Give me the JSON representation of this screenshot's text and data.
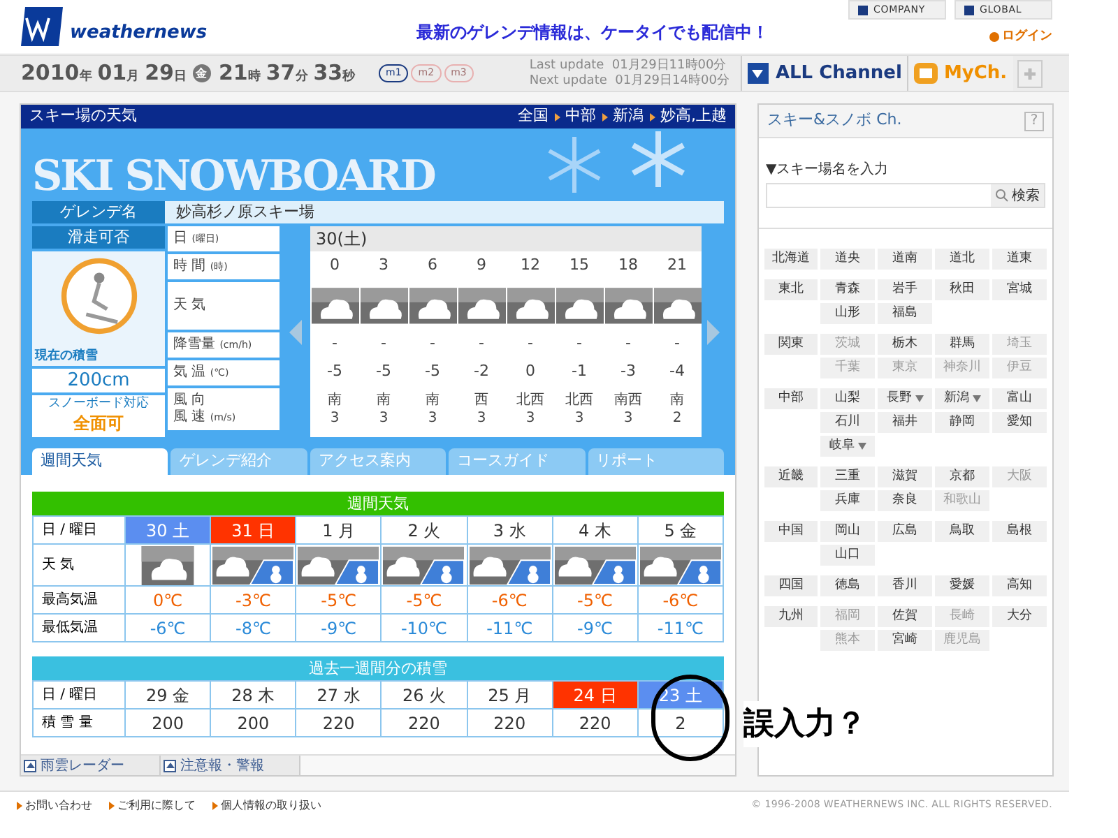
{
  "header": {
    "logo": "weathernews",
    "promo": "最新のゲレンデ情報は、ケータイでも配信中！",
    "links": [
      "COMPANY",
      "GLOBAL"
    ],
    "login": "ログイン"
  },
  "datebar": {
    "parts": [
      {
        "text": "2010",
        "kind": "num"
      },
      {
        "text": "年",
        "kind": "unit"
      },
      {
        "text": "01",
        "kind": "num"
      },
      {
        "text": "月",
        "kind": "unit"
      },
      {
        "text": "29",
        "kind": "num"
      },
      {
        "text": "日",
        "kind": "unit"
      },
      {
        "text": "金",
        "kind": "badge"
      },
      {
        "text": "21",
        "kind": "num"
      },
      {
        "text": "時",
        "kind": "unit"
      },
      {
        "text": "37",
        "kind": "num"
      },
      {
        "text": "分",
        "kind": "unit"
      },
      {
        "text": "33",
        "kind": "num"
      },
      {
        "text": "秒",
        "kind": "unit"
      }
    ],
    "modes": [
      {
        "label": "m1",
        "selected": true
      },
      {
        "label": "m2",
        "selected": false
      },
      {
        "label": "m3",
        "selected": false
      }
    ],
    "updates": [
      {
        "label": "Last update",
        "time": "01月29日11時00分"
      },
      {
        "label": "Next update",
        "time": "01月29日14時00分"
      }
    ],
    "all_channel": "ALL Channel",
    "my_channel": "MyCh."
  },
  "resort": {
    "title": "スキー場の天気",
    "breadcrumb": [
      "全国",
      "中部",
      "新潟",
      "妙高,上越"
    ],
    "banner": "SKI SNOWBOARD",
    "name_label": "ゲレンデ名",
    "name": "妙高杉ノ原スキー場",
    "status_label": "滑走可否",
    "snow_label": "現在の積雪",
    "snow_depth": "200cm",
    "board_label": "スノーボード対応",
    "board_status": "全面可",
    "forecast": {
      "date": "30(土)",
      "rows": [
        {
          "kind": "date",
          "label": "日",
          "unit": "(曜日)"
        },
        {
          "kind": "text",
          "label": "時 間",
          "unit": "(時)",
          "values": [
            "0",
            "3",
            "6",
            "9",
            "12",
            "15",
            "18",
            "21"
          ]
        },
        {
          "kind": "weather",
          "label": "天 気",
          "values": [
            {
              "kind": "cloudy"
            },
            {
              "kind": "cloudy"
            },
            {
              "kind": "cloudy"
            },
            {
              "kind": "cloudy"
            },
            {
              "kind": "cloudy"
            },
            {
              "kind": "cloudy"
            },
            {
              "kind": "cloudy"
            },
            {
              "kind": "cloudy"
            }
          ]
        },
        {
          "kind": "text",
          "label": "降雪量",
          "unit": "(cm/h)",
          "values": [
            "-",
            "-",
            "-",
            "-",
            "-",
            "-",
            "-",
            "-"
          ]
        },
        {
          "kind": "text",
          "label": "気 温",
          "unit": "(℃)",
          "values": [
            "-5",
            "-5",
            "-5",
            "-2",
            "0",
            "-1",
            "-3",
            "-4"
          ]
        },
        {
          "kind": "wind",
          "label": "風 向",
          "label2": "風 速",
          "unit": "(m/s)",
          "values": [
            "南",
            "南",
            "南",
            "西",
            "北西",
            "北西",
            "南西",
            "南"
          ],
          "values2": [
            "3",
            "3",
            "3",
            "3",
            "3",
            "3",
            "3",
            "2"
          ]
        }
      ]
    }
  },
  "tabs": [
    {
      "label": "週間天気",
      "selected": true
    },
    {
      "label": "ゲレンデ紹介",
      "selected": false
    },
    {
      "label": "アクセス案内",
      "selected": false
    },
    {
      "label": "コースガイド",
      "selected": false
    },
    {
      "label": "リポート",
      "selected": false
    }
  ],
  "weekly": {
    "title": "週間天気",
    "day_label": "日 / 曜日",
    "weather_label": "天 気",
    "max_label": "最高気温",
    "min_label": "最低気温",
    "days": [
      {
        "day": "30 土",
        "kind": "saturday",
        "weather": {
          "kind": "cloudy"
        },
        "max": "0℃",
        "min": "-6℃"
      },
      {
        "day": "31 日",
        "kind": "sunday",
        "weather": {
          "kind": "cloudy_snow"
        },
        "max": "-3℃",
        "min": "-8℃"
      },
      {
        "day": "1 月",
        "kind": "weekday",
        "weather": {
          "kind": "cloudy_snow"
        },
        "max": "-5℃",
        "min": "-9℃"
      },
      {
        "day": "2 火",
        "kind": "weekday",
        "weather": {
          "kind": "cloudy_snow"
        },
        "max": "-5℃",
        "min": "-10℃"
      },
      {
        "day": "3 水",
        "kind": "weekday",
        "weather": {
          "kind": "cloudy_snow"
        },
        "max": "-6℃",
        "min": "-11℃"
      },
      {
        "day": "4 木",
        "kind": "weekday",
        "weather": {
          "kind": "cloudy_snow"
        },
        "max": "-5℃",
        "min": "-9℃"
      },
      {
        "day": "5 金",
        "kind": "weekday",
        "weather": {
          "kind": "cloudy_snow"
        },
        "max": "-6℃",
        "min": "-11℃"
      }
    ]
  },
  "past": {
    "title": "過去一週間分の積雪",
    "day_label": "日 / 曜日",
    "depth_label": "積 雪 量",
    "days": [
      {
        "day": "29 金",
        "kind": "weekday",
        "depth": "200"
      },
      {
        "day": "28 木",
        "kind": "weekday",
        "depth": "200"
      },
      {
        "day": "27 水",
        "kind": "weekday",
        "depth": "220"
      },
      {
        "day": "26 火",
        "kind": "weekday",
        "depth": "220"
      },
      {
        "day": "25 月",
        "kind": "weekday",
        "depth": "220"
      },
      {
        "day": "24 日",
        "kind": "sunday",
        "depth": "220"
      },
      {
        "day": "23 土",
        "kind": "saturday",
        "depth": "2"
      }
    ]
  },
  "bottom_tabs": [
    "雨雲レーダー",
    "注意報・警報"
  ],
  "annotation": "誤入力？",
  "sidebar": {
    "title": "スキー&スノボ Ch.",
    "help": "?",
    "search_label": "▼スキー場名を入力",
    "search_button": "検索",
    "regions": [
      {
        "name": "北海道",
        "prefs": [
          {
            "name": "道央",
            "disabled": false
          },
          {
            "name": "道南",
            "disabled": false
          },
          {
            "name": "道北",
            "disabled": false
          },
          {
            "name": "道東",
            "disabled": false
          }
        ]
      },
      {
        "name": "東北",
        "prefs": [
          {
            "name": "青森",
            "disabled": false
          },
          {
            "name": "岩手",
            "disabled": false
          },
          {
            "name": "秋田",
            "disabled": false
          },
          {
            "name": "宮城",
            "disabled": false
          },
          {
            "name": "山形",
            "disabled": false
          },
          {
            "name": "福島",
            "disabled": false
          }
        ]
      },
      {
        "name": "関東",
        "prefs": [
          {
            "name": "茨城",
            "disabled": true
          },
          {
            "name": "栃木",
            "disabled": false
          },
          {
            "name": "群馬",
            "disabled": false
          },
          {
            "name": "埼玉",
            "disabled": true
          },
          {
            "name": "千葉",
            "disabled": true
          },
          {
            "name": "東京",
            "disabled": true
          },
          {
            "name": "神奈川",
            "disabled": true
          },
          {
            "name": "伊豆",
            "disabled": true
          }
        ]
      },
      {
        "name": "中部",
        "prefs": [
          {
            "name": "山梨",
            "disabled": false
          },
          {
            "name": "長野",
            "disabled": false,
            "menu": true
          },
          {
            "name": "新潟",
            "disabled": false,
            "menu": true
          },
          {
            "name": "富山",
            "disabled": false
          },
          {
            "name": "石川",
            "disabled": false
          },
          {
            "name": "福井",
            "disabled": false
          },
          {
            "name": "静岡",
            "disabled": false
          },
          {
            "name": "愛知",
            "disabled": false
          },
          {
            "name": "岐阜",
            "disabled": false,
            "menu": true
          }
        ]
      },
      {
        "name": "近畿",
        "prefs": [
          {
            "name": "三重",
            "disabled": false
          },
          {
            "name": "滋賀",
            "disabled": false
          },
          {
            "name": "京都",
            "disabled": false
          },
          {
            "name": "大阪",
            "disabled": true
          },
          {
            "name": "兵庫",
            "disabled": false
          },
          {
            "name": "奈良",
            "disabled": false
          },
          {
            "name": "和歌山",
            "disabled": true
          }
        ]
      },
      {
        "name": "中国",
        "prefs": [
          {
            "name": "岡山",
            "disabled": false
          },
          {
            "name": "広島",
            "disabled": false
          },
          {
            "name": "鳥取",
            "disabled": false
          },
          {
            "name": "島根",
            "disabled": false
          },
          {
            "name": "山口",
            "disabled": false
          }
        ]
      },
      {
        "name": "四国",
        "prefs": [
          {
            "name": "徳島",
            "disabled": false
          },
          {
            "name": "香川",
            "disabled": false
          },
          {
            "name": "愛媛",
            "disabled": false
          },
          {
            "name": "高知",
            "disabled": false
          }
        ]
      },
      {
        "name": "九州",
        "prefs": [
          {
            "name": "福岡",
            "disabled": true
          },
          {
            "name": "佐賀",
            "disabled": false
          },
          {
            "name": "長崎",
            "disabled": true
          },
          {
            "name": "大分",
            "disabled": false
          },
          {
            "name": "熊本",
            "disabled": true
          },
          {
            "name": "宮崎",
            "disabled": false
          },
          {
            "name": "鹿児島",
            "disabled": true
          }
        ]
      }
    ]
  },
  "footer": {
    "links": [
      "お問い合わせ",
      "ご利用に際して",
      "個人情報の取り扱い"
    ],
    "copyright": "© 1996-2008 WEATHERNEWS INC. ALL RIGHTS RESERVED."
  }
}
